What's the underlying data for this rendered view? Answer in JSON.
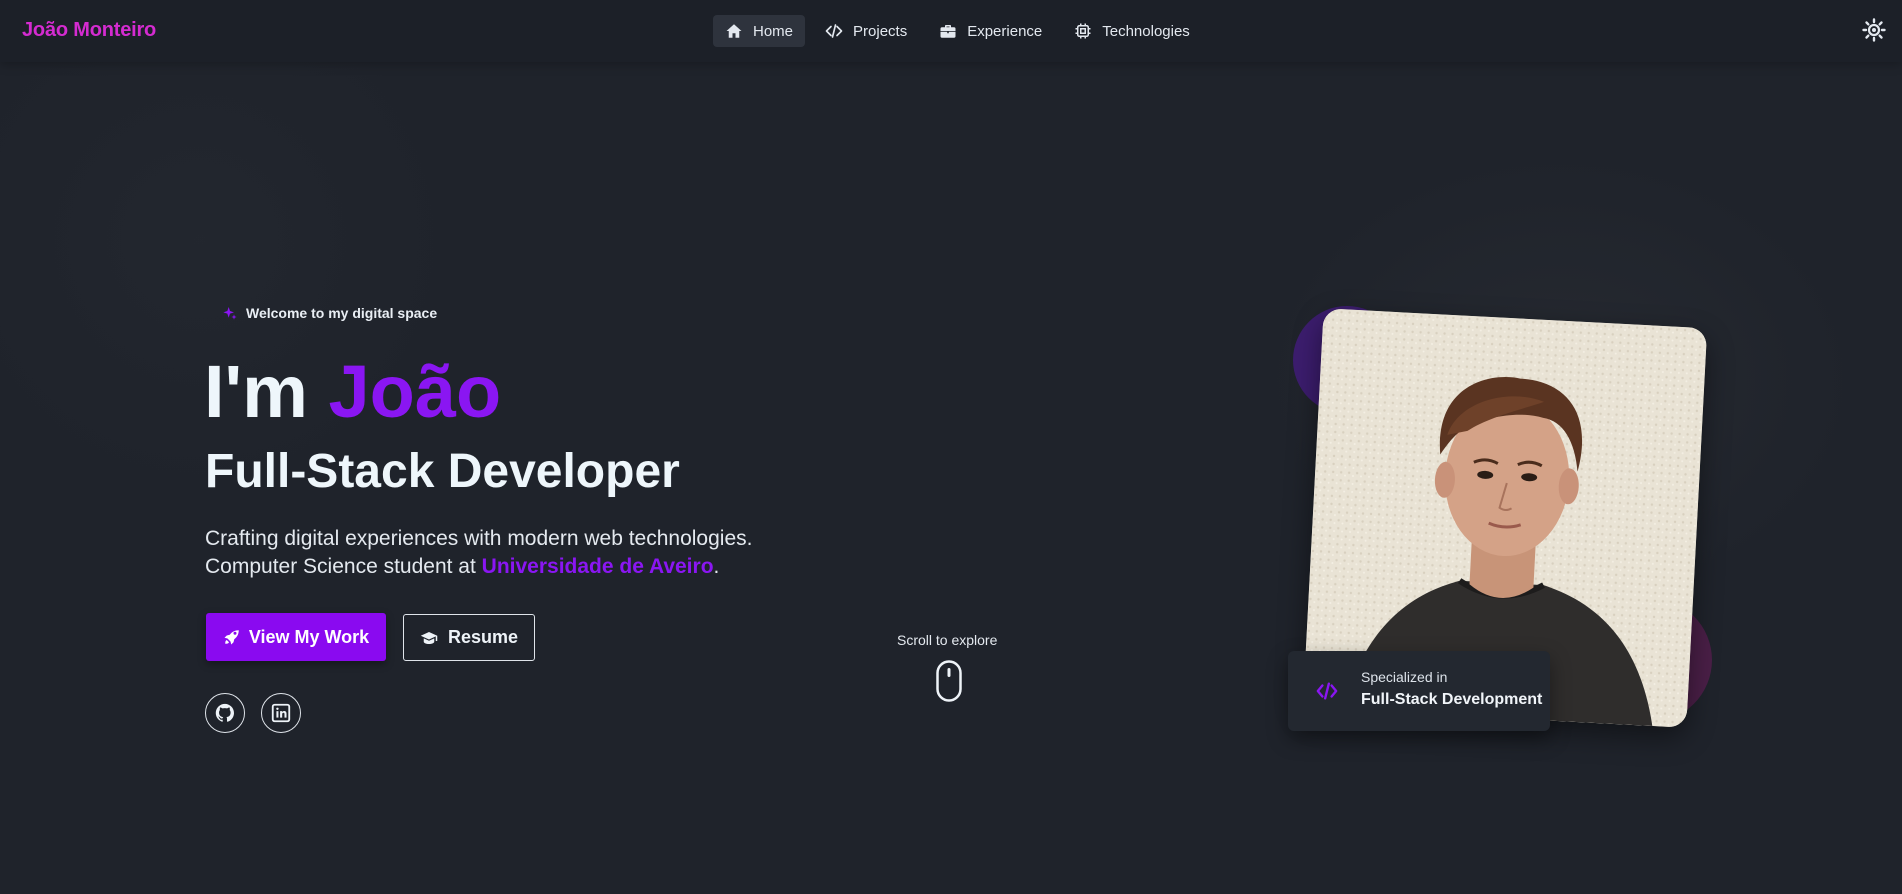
{
  "brand": {
    "name": "João Monteiro"
  },
  "nav": {
    "items": [
      {
        "label": "Home",
        "icon": "home-icon",
        "active": true
      },
      {
        "label": "Projects",
        "icon": "code-icon",
        "active": false
      },
      {
        "label": "Experience",
        "icon": "briefcase-icon",
        "active": false
      },
      {
        "label": "Technologies",
        "icon": "chip-icon",
        "active": false
      }
    ],
    "theme_toggle_icon": "sun-icon"
  },
  "hero": {
    "welcome": "Welcome to my digital space",
    "title_prefix": "I'm ",
    "title_name": "João",
    "role": "Full-Stack Developer",
    "desc_line1": "Crafting digital experiences with modern web technologies.",
    "desc_line2_prefix": "Computer Science student at ",
    "university": "Universidade de Aveiro",
    "desc_line2_suffix": ".",
    "primary_button": "View My Work",
    "secondary_button": "Resume",
    "social": [
      {
        "name": "github-icon"
      },
      {
        "name": "linkedin-icon"
      }
    ]
  },
  "scroll": {
    "label": "Scroll to explore"
  },
  "specialty": {
    "label": "Specialized in",
    "value": "Full-Stack Development"
  },
  "colors": {
    "accent": "#8a16f2",
    "brand": "#d42bd0",
    "background": "#1f232b"
  }
}
